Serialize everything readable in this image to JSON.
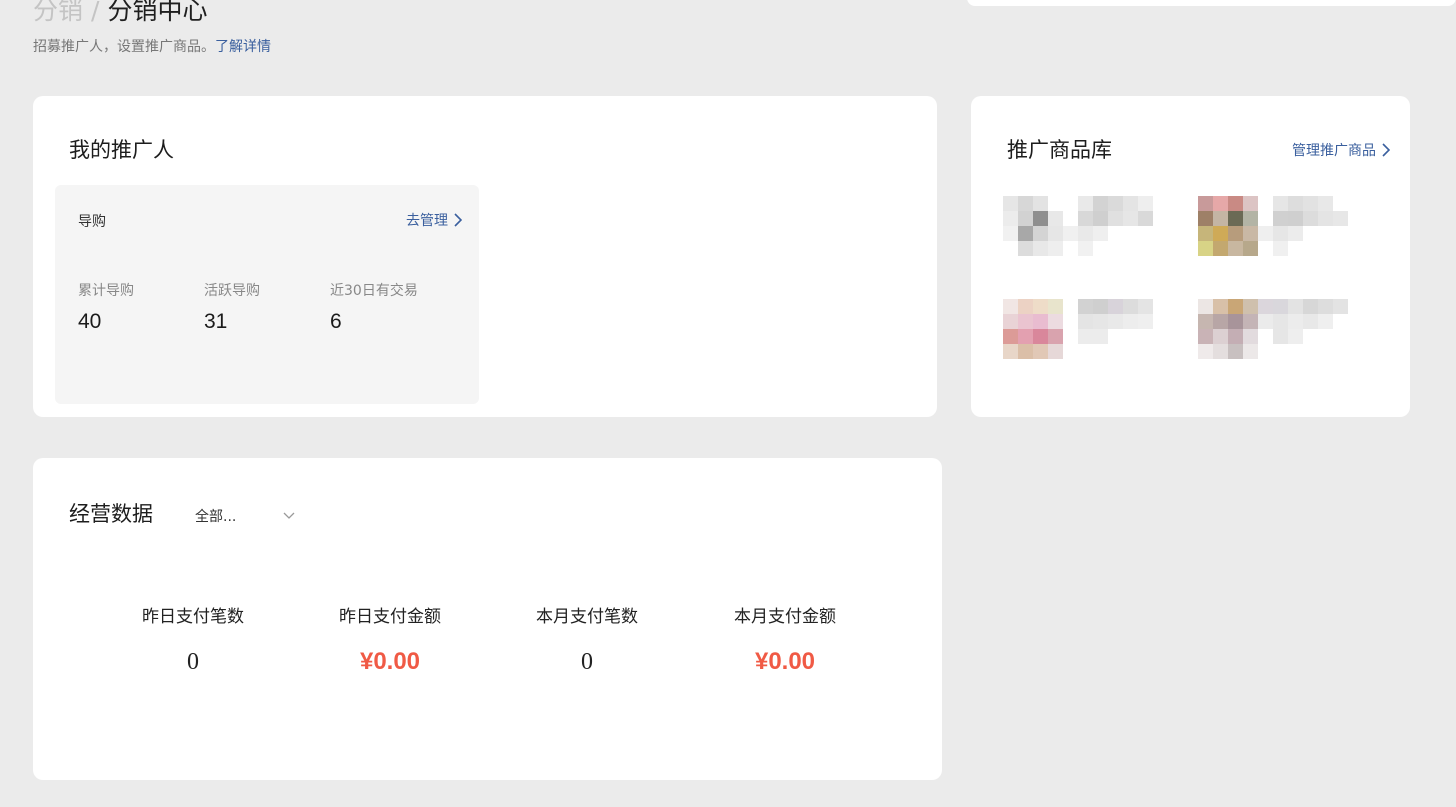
{
  "breadcrumb": {
    "parent": "分销",
    "separator": "/",
    "current": "分销中心"
  },
  "subtitle": {
    "text": "招募推广人，设置推广商品。",
    "link": "了解详情"
  },
  "promoters": {
    "title": "我的推广人",
    "guide": {
      "title": "导购",
      "manage_link": "去管理",
      "stats": [
        {
          "label": "累计导购",
          "value": "40"
        },
        {
          "label": "活跃导购",
          "value": "31"
        },
        {
          "label": "近30日有交易",
          "value": "6"
        }
      ]
    }
  },
  "products": {
    "title": "推广商品库",
    "manage_link": "管理推广商品",
    "thumb_icon": "blurred-product-image"
  },
  "business": {
    "title": "经营数据",
    "filter": {
      "selected": "全部..."
    },
    "metrics": [
      {
        "label": "昨日支付笔数",
        "value": "0",
        "kind": "count"
      },
      {
        "label": "昨日支付金额",
        "value": "¥0.00",
        "kind": "money"
      },
      {
        "label": "本月支付笔数",
        "value": "0",
        "kind": "count"
      },
      {
        "label": "本月支付金额",
        "value": "¥0.00",
        "kind": "money"
      }
    ]
  },
  "colors": {
    "link": "#3a5f9e",
    "money": "#f05a45",
    "background": "#ebebeb"
  }
}
